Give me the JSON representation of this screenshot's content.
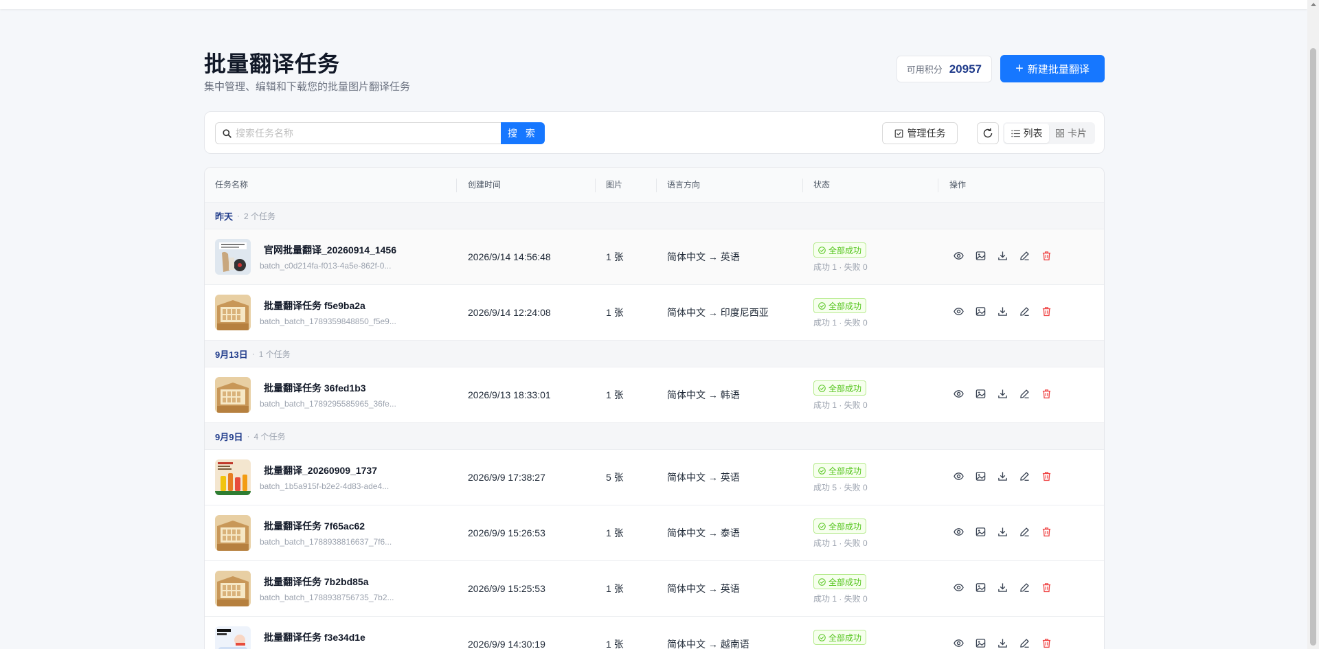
{
  "header": {
    "title": "批量翻译任务",
    "subtitle": "集中管理、编辑和下载您的批量图片翻译任务",
    "credits_label": "可用积分",
    "credits_value": "20957",
    "new_button": "新建批量翻译"
  },
  "toolbar": {
    "search_placeholder": "搜索任务名称",
    "search_button": "搜 索",
    "manage_button": "管理任务",
    "view_list": "列表",
    "view_card": "卡片"
  },
  "columns": [
    "任务名称",
    "创建时间",
    "图片",
    "语言方向",
    "状态",
    "操作"
  ],
  "groups": [
    {
      "label": "昨天",
      "count": "2 个任务",
      "rows": [
        {
          "name": "官网批量翻译_20260914_1456",
          "id": "batch_c0d214fa-f013-4a5e-862f-0...",
          "time": "2026/9/14 14:56:48",
          "images": "1 张",
          "lang": "简体中文 → 英语",
          "status": "全部成功",
          "status_sub": "成功 1 · 失败 0",
          "thumb": "thumb-cover"
        },
        {
          "name": "批量翻译任务 f5e9ba2a",
          "id": "batch_batch_1789359848850_f5e9...",
          "time": "2026/9/14 12:24:08",
          "images": "1 张",
          "lang": "简体中文 → 印度尼西亚",
          "status": "全部成功",
          "status_sub": "成功 1 · 失败 0",
          "thumb": "thumb-box"
        }
      ]
    },
    {
      "label": "9月13日",
      "count": "1 个任务",
      "rows": [
        {
          "name": "批量翻译任务 36fed1b3",
          "id": "batch_batch_1789295585965_36fe...",
          "time": "2026/9/13 18:33:01",
          "images": "1 张",
          "lang": "简体中文 → 韩语",
          "status": "全部成功",
          "status_sub": "成功 1 · 失败 0",
          "thumb": "thumb-box"
        }
      ]
    },
    {
      "label": "9月9日",
      "count": "4 个任务",
      "rows": [
        {
          "name": "批量翻译_20260909_1737",
          "id": "batch_1b5a915f-b2e2-4d83-ade4...",
          "time": "2026/9/9 17:38:27",
          "images": "5 张",
          "lang": "简体中文 → 英语",
          "status": "全部成功",
          "status_sub": "成功 5 · 失败 0",
          "thumb": "thumb-bottles"
        },
        {
          "name": "批量翻译任务 7f65ac62",
          "id": "batch_batch_1788938816637_7f6...",
          "time": "2026/9/9 15:26:53",
          "images": "1 张",
          "lang": "简体中文 → 泰语",
          "status": "全部成功",
          "status_sub": "成功 1 · 失败 0",
          "thumb": "thumb-box"
        },
        {
          "name": "批量翻译任务 7b2bd85a",
          "id": "batch_batch_1788938756735_7b2...",
          "time": "2026/9/9 15:25:53",
          "images": "1 张",
          "lang": "简体中文 → 英语",
          "status": "全部成功",
          "status_sub": "成功 1 · 失败 0",
          "thumb": "thumb-box"
        },
        {
          "name": "批量翻译任务 f3e34d1e",
          "id": "",
          "time": "2026/9/9 14:30:19",
          "images": "1 张",
          "lang": "简体中文 → 越南语",
          "status": "全部成功",
          "status_sub": "",
          "thumb": "thumb-cartoon"
        }
      ]
    }
  ],
  "colors": {
    "primary": "#1677ff",
    "success": "#52c41a",
    "danger": "#ef4444",
    "group_label": "#1e3a8a"
  }
}
